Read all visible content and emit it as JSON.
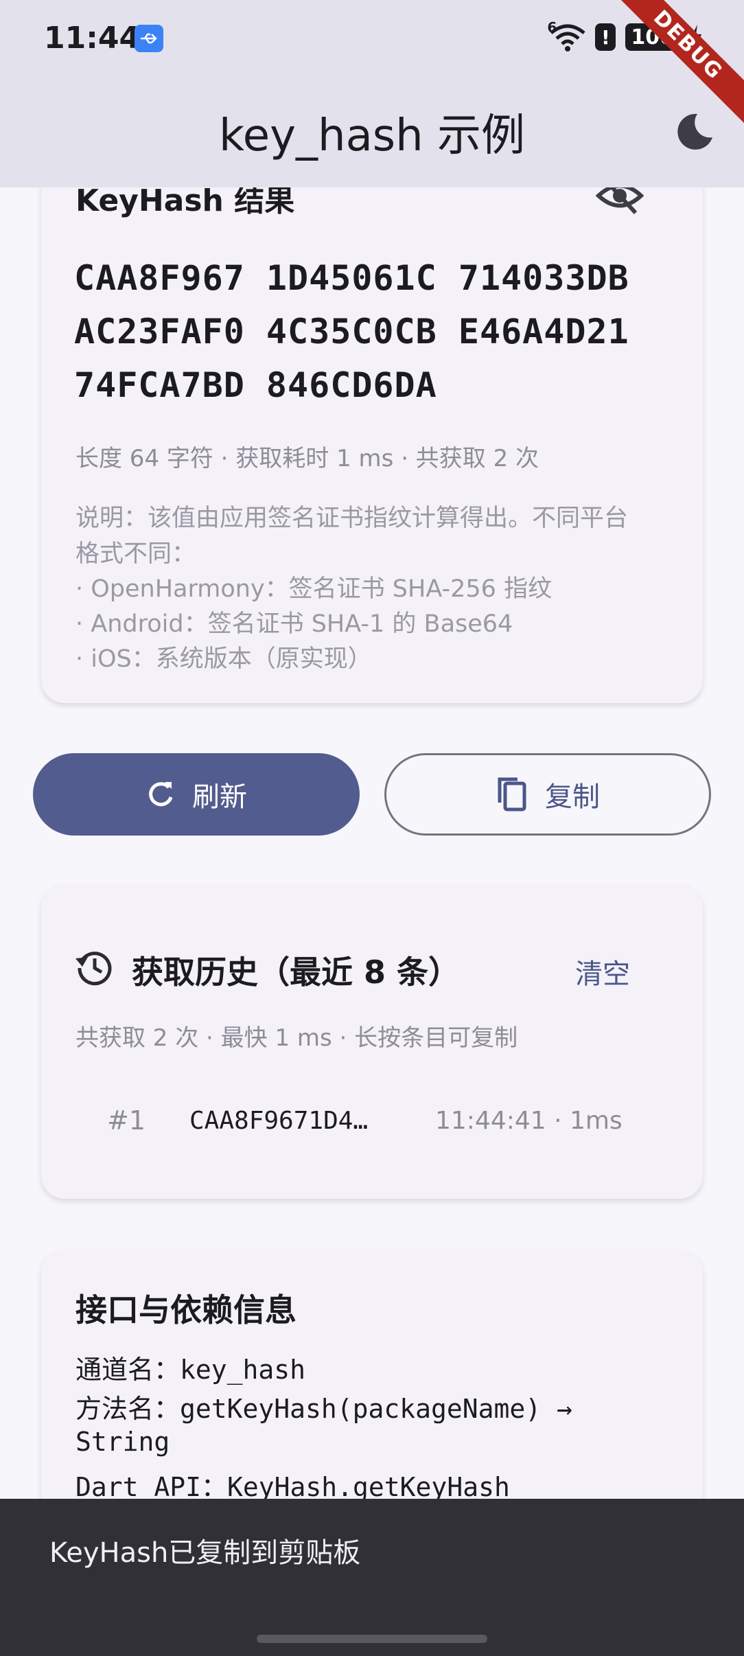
{
  "status_bar": {
    "time": "11:44",
    "battery": "100",
    "signal_label": "6",
    "alert_glyph": "!",
    "icons": [
      "usb-icon",
      "wifi-icon",
      "alert-icon",
      "battery-icon",
      "charging-icon"
    ]
  },
  "debug_banner": "DEBUG",
  "app_bar": {
    "title": "key_hash 示例",
    "theme_icon": "dark-mode-icon"
  },
  "result_card": {
    "title": "KeyHash 结果",
    "visibility_icon": "visibility-off-icon",
    "hash_lines": [
      "CAA8F967 1D45061C 714033DB",
      "AC23FAF0 4C35C0CB E46A4D21",
      "74FCA7BD 846CD6DA"
    ],
    "meta": "长度 64 字符 · 获取耗时 1 ms · 共获取 2 次",
    "description_lines": [
      "说明：该值由应用签名证书指纹计算得出。不同平台",
      "格式不同：",
      "· OpenHarmony：签名证书 SHA-256 指纹",
      "· Android：签名证书 SHA-1 的 Base64",
      "· iOS：系统版本（原实现）"
    ]
  },
  "actions": {
    "refresh_label": "刷新",
    "copy_label": "复制",
    "refresh_icon": "refresh-icon",
    "copy_icon": "copy-icon"
  },
  "history_card": {
    "title": "获取历史（最近 8 条）",
    "clear_label": "清空",
    "subtitle": "共获取 2 次 · 最快 1 ms · 长按条目可复制",
    "items": [
      {
        "index": "#1",
        "hash": "CAA8F9671D4…",
        "time": "11:44:41 · 1ms"
      }
    ]
  },
  "info_card": {
    "title": "接口与依赖信息",
    "lines": [
      "通道名：key_hash",
      "方法名：getKeyHash(packageName) →",
      "String",
      "Dart API：KeyHash.getKeyHash"
    ]
  },
  "snackbar": {
    "message": "KeyHash已复制到剪贴板"
  },
  "colors": {
    "primary": "#525c8e",
    "app_bar_bg": "#e3e2ec",
    "page_bg": "#f7f6fb",
    "card_bg": "#f4f2f8",
    "snackbar_bg": "#313036",
    "debug_ribbon": "#b3261e"
  }
}
